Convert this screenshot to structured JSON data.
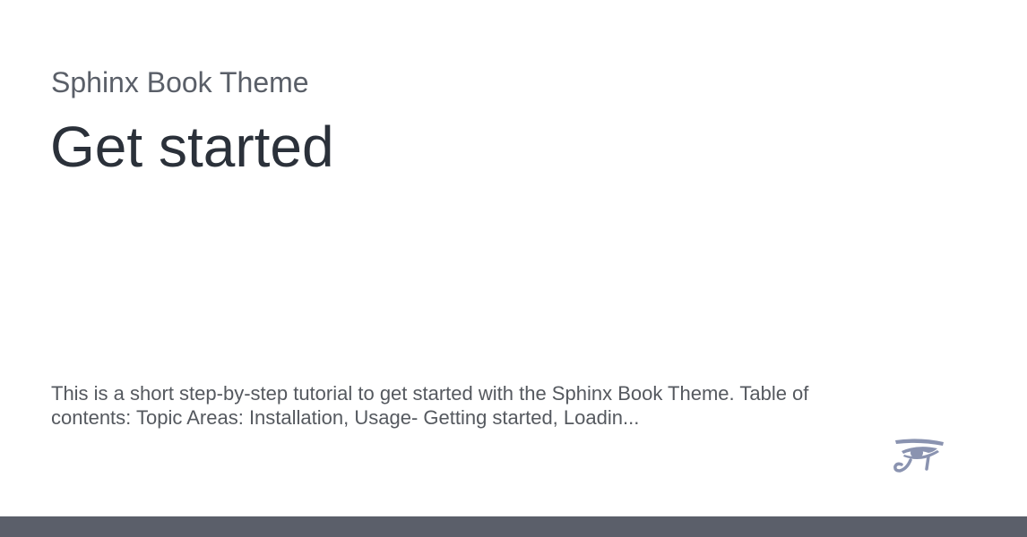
{
  "card": {
    "site_name": "Sphinx Book Theme",
    "title": "Get started",
    "description": "This is a short step-by-step tutorial to get started with the Sphinx Book Theme. Table of contents: Topic Areas: Installation, Usage- Getting started, Loadin...",
    "logo_icon": "eye-of-horus-logo-icon"
  },
  "colors": {
    "background": "#ffffff",
    "site_name": "#5a5f68",
    "title": "#2b313a",
    "description": "#55595f",
    "logo": "#8a93b0",
    "footer_bar": "#5b5f6a"
  }
}
